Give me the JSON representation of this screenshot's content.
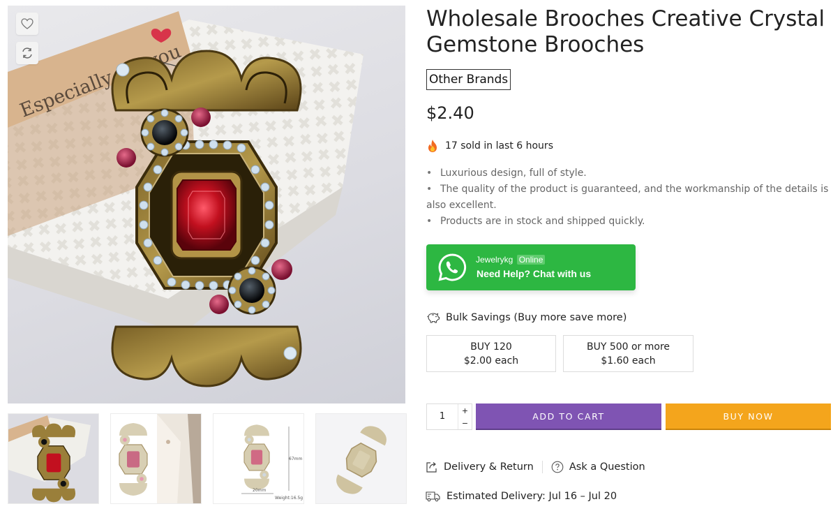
{
  "product": {
    "title": "Wholesale Brooches Creative Crystal Gemstone Brooches",
    "brand": "Other Brands",
    "price": "$2.40",
    "sold_text": "17 sold in last 6 hours",
    "features": [
      "Luxurious design, full of style.",
      "The quality of the product is guaranteed, and the workmanship of the details is also excellent.",
      "Products are in stock and shipped quickly."
    ],
    "box_tag_text": "Especially for you"
  },
  "gallery": {
    "wishlist_icon": "heart-icon",
    "compare_icon": "refresh-icon",
    "thumbnails": [
      "thumb-1",
      "thumb-2",
      "thumb-3",
      "thumb-4"
    ],
    "dimension_labels": {
      "height": "67mm",
      "width": "20mm",
      "weight": "Weight:16.5g"
    }
  },
  "chat": {
    "name": "Jewelrykg",
    "status": "Online",
    "cta": "Need Help? Chat with us",
    "color": "#2db742"
  },
  "bulk": {
    "heading": "Bulk Savings (Buy more save more)",
    "tiers": [
      {
        "qty": "BUY 120",
        "price": "$2.00 each"
      },
      {
        "qty": "BUY 500 or more",
        "price": "$1.60 each"
      }
    ]
  },
  "purchase": {
    "quantity": "1",
    "plus": "+",
    "minus": "−",
    "add_to_cart": "ADD TO CART",
    "buy_now": "BUY NOW",
    "cart_color": "#7f54b3",
    "buy_color": "#f4a51c"
  },
  "links": {
    "delivery_return": "Delivery & Return",
    "ask_question": "Ask a Question"
  },
  "delivery": {
    "estimated": "Estimated Delivery: Jul 16 – Jul 20"
  }
}
